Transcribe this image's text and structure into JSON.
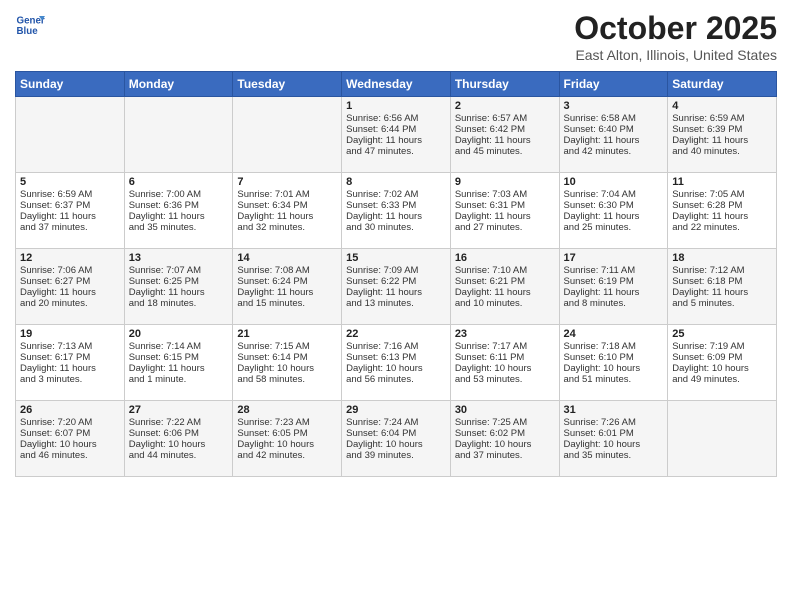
{
  "header": {
    "logo_line1": "General",
    "logo_line2": "Blue",
    "month": "October 2025",
    "location": "East Alton, Illinois, United States"
  },
  "weekdays": [
    "Sunday",
    "Monday",
    "Tuesday",
    "Wednesday",
    "Thursday",
    "Friday",
    "Saturday"
  ],
  "weeks": [
    [
      {
        "day": "",
        "content": ""
      },
      {
        "day": "",
        "content": ""
      },
      {
        "day": "",
        "content": ""
      },
      {
        "day": "1",
        "content": "Sunrise: 6:56 AM\nSunset: 6:44 PM\nDaylight: 11 hours\nand 47 minutes."
      },
      {
        "day": "2",
        "content": "Sunrise: 6:57 AM\nSunset: 6:42 PM\nDaylight: 11 hours\nand 45 minutes."
      },
      {
        "day": "3",
        "content": "Sunrise: 6:58 AM\nSunset: 6:40 PM\nDaylight: 11 hours\nand 42 minutes."
      },
      {
        "day": "4",
        "content": "Sunrise: 6:59 AM\nSunset: 6:39 PM\nDaylight: 11 hours\nand 40 minutes."
      }
    ],
    [
      {
        "day": "5",
        "content": "Sunrise: 6:59 AM\nSunset: 6:37 PM\nDaylight: 11 hours\nand 37 minutes."
      },
      {
        "day": "6",
        "content": "Sunrise: 7:00 AM\nSunset: 6:36 PM\nDaylight: 11 hours\nand 35 minutes."
      },
      {
        "day": "7",
        "content": "Sunrise: 7:01 AM\nSunset: 6:34 PM\nDaylight: 11 hours\nand 32 minutes."
      },
      {
        "day": "8",
        "content": "Sunrise: 7:02 AM\nSunset: 6:33 PM\nDaylight: 11 hours\nand 30 minutes."
      },
      {
        "day": "9",
        "content": "Sunrise: 7:03 AM\nSunset: 6:31 PM\nDaylight: 11 hours\nand 27 minutes."
      },
      {
        "day": "10",
        "content": "Sunrise: 7:04 AM\nSunset: 6:30 PM\nDaylight: 11 hours\nand 25 minutes."
      },
      {
        "day": "11",
        "content": "Sunrise: 7:05 AM\nSunset: 6:28 PM\nDaylight: 11 hours\nand 22 minutes."
      }
    ],
    [
      {
        "day": "12",
        "content": "Sunrise: 7:06 AM\nSunset: 6:27 PM\nDaylight: 11 hours\nand 20 minutes."
      },
      {
        "day": "13",
        "content": "Sunrise: 7:07 AM\nSunset: 6:25 PM\nDaylight: 11 hours\nand 18 minutes."
      },
      {
        "day": "14",
        "content": "Sunrise: 7:08 AM\nSunset: 6:24 PM\nDaylight: 11 hours\nand 15 minutes."
      },
      {
        "day": "15",
        "content": "Sunrise: 7:09 AM\nSunset: 6:22 PM\nDaylight: 11 hours\nand 13 minutes."
      },
      {
        "day": "16",
        "content": "Sunrise: 7:10 AM\nSunset: 6:21 PM\nDaylight: 11 hours\nand 10 minutes."
      },
      {
        "day": "17",
        "content": "Sunrise: 7:11 AM\nSunset: 6:19 PM\nDaylight: 11 hours\nand 8 minutes."
      },
      {
        "day": "18",
        "content": "Sunrise: 7:12 AM\nSunset: 6:18 PM\nDaylight: 11 hours\nand 5 minutes."
      }
    ],
    [
      {
        "day": "19",
        "content": "Sunrise: 7:13 AM\nSunset: 6:17 PM\nDaylight: 11 hours\nand 3 minutes."
      },
      {
        "day": "20",
        "content": "Sunrise: 7:14 AM\nSunset: 6:15 PM\nDaylight: 11 hours\nand 1 minute."
      },
      {
        "day": "21",
        "content": "Sunrise: 7:15 AM\nSunset: 6:14 PM\nDaylight: 10 hours\nand 58 minutes."
      },
      {
        "day": "22",
        "content": "Sunrise: 7:16 AM\nSunset: 6:13 PM\nDaylight: 10 hours\nand 56 minutes."
      },
      {
        "day": "23",
        "content": "Sunrise: 7:17 AM\nSunset: 6:11 PM\nDaylight: 10 hours\nand 53 minutes."
      },
      {
        "day": "24",
        "content": "Sunrise: 7:18 AM\nSunset: 6:10 PM\nDaylight: 10 hours\nand 51 minutes."
      },
      {
        "day": "25",
        "content": "Sunrise: 7:19 AM\nSunset: 6:09 PM\nDaylight: 10 hours\nand 49 minutes."
      }
    ],
    [
      {
        "day": "26",
        "content": "Sunrise: 7:20 AM\nSunset: 6:07 PM\nDaylight: 10 hours\nand 46 minutes."
      },
      {
        "day": "27",
        "content": "Sunrise: 7:22 AM\nSunset: 6:06 PM\nDaylight: 10 hours\nand 44 minutes."
      },
      {
        "day": "28",
        "content": "Sunrise: 7:23 AM\nSunset: 6:05 PM\nDaylight: 10 hours\nand 42 minutes."
      },
      {
        "day": "29",
        "content": "Sunrise: 7:24 AM\nSunset: 6:04 PM\nDaylight: 10 hours\nand 39 minutes."
      },
      {
        "day": "30",
        "content": "Sunrise: 7:25 AM\nSunset: 6:02 PM\nDaylight: 10 hours\nand 37 minutes."
      },
      {
        "day": "31",
        "content": "Sunrise: 7:26 AM\nSunset: 6:01 PM\nDaylight: 10 hours\nand 35 minutes."
      },
      {
        "day": "",
        "content": ""
      }
    ]
  ]
}
